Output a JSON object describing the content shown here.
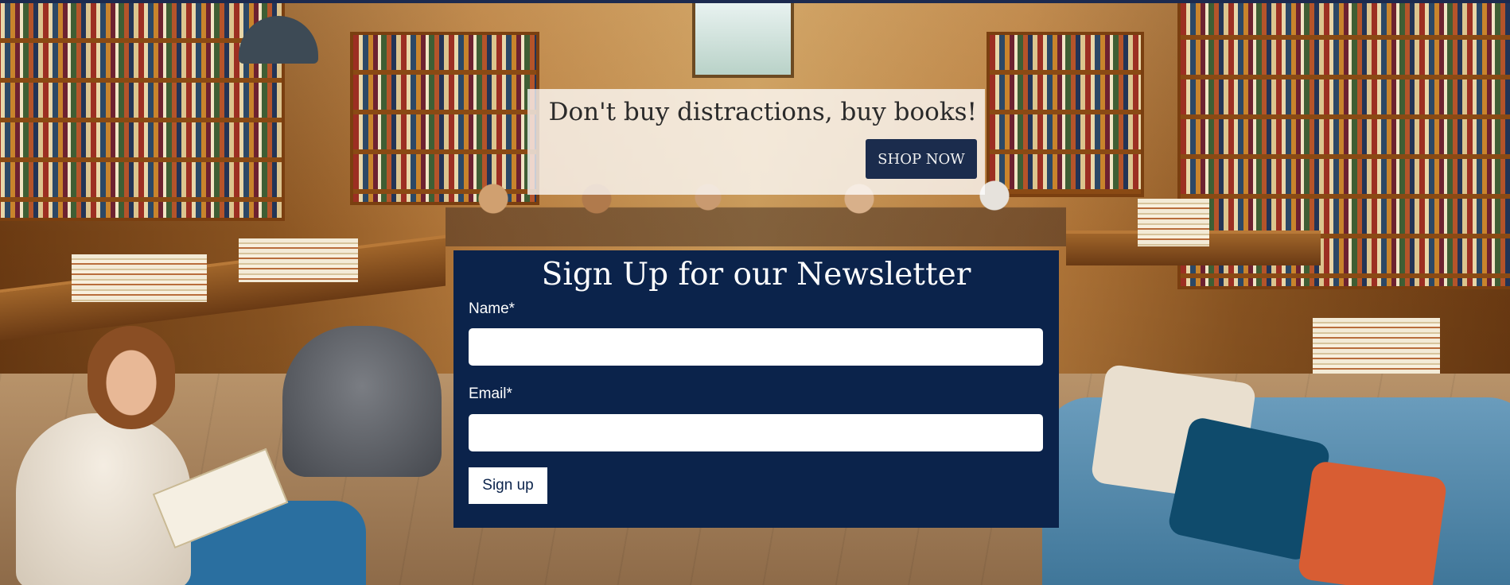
{
  "hero": {
    "title": "Don't buy distractions, buy books!",
    "button_label": "SHOP NOW"
  },
  "newsletter": {
    "title": "Sign Up for our Newsletter",
    "name_label": "Name*",
    "name_value": "",
    "email_label": "Email*",
    "email_value": "",
    "submit_label": "Sign up"
  },
  "colors": {
    "navy": "#0b234b",
    "button_dark": "#1b2c4d",
    "top_bar": "#1c2a4f"
  }
}
